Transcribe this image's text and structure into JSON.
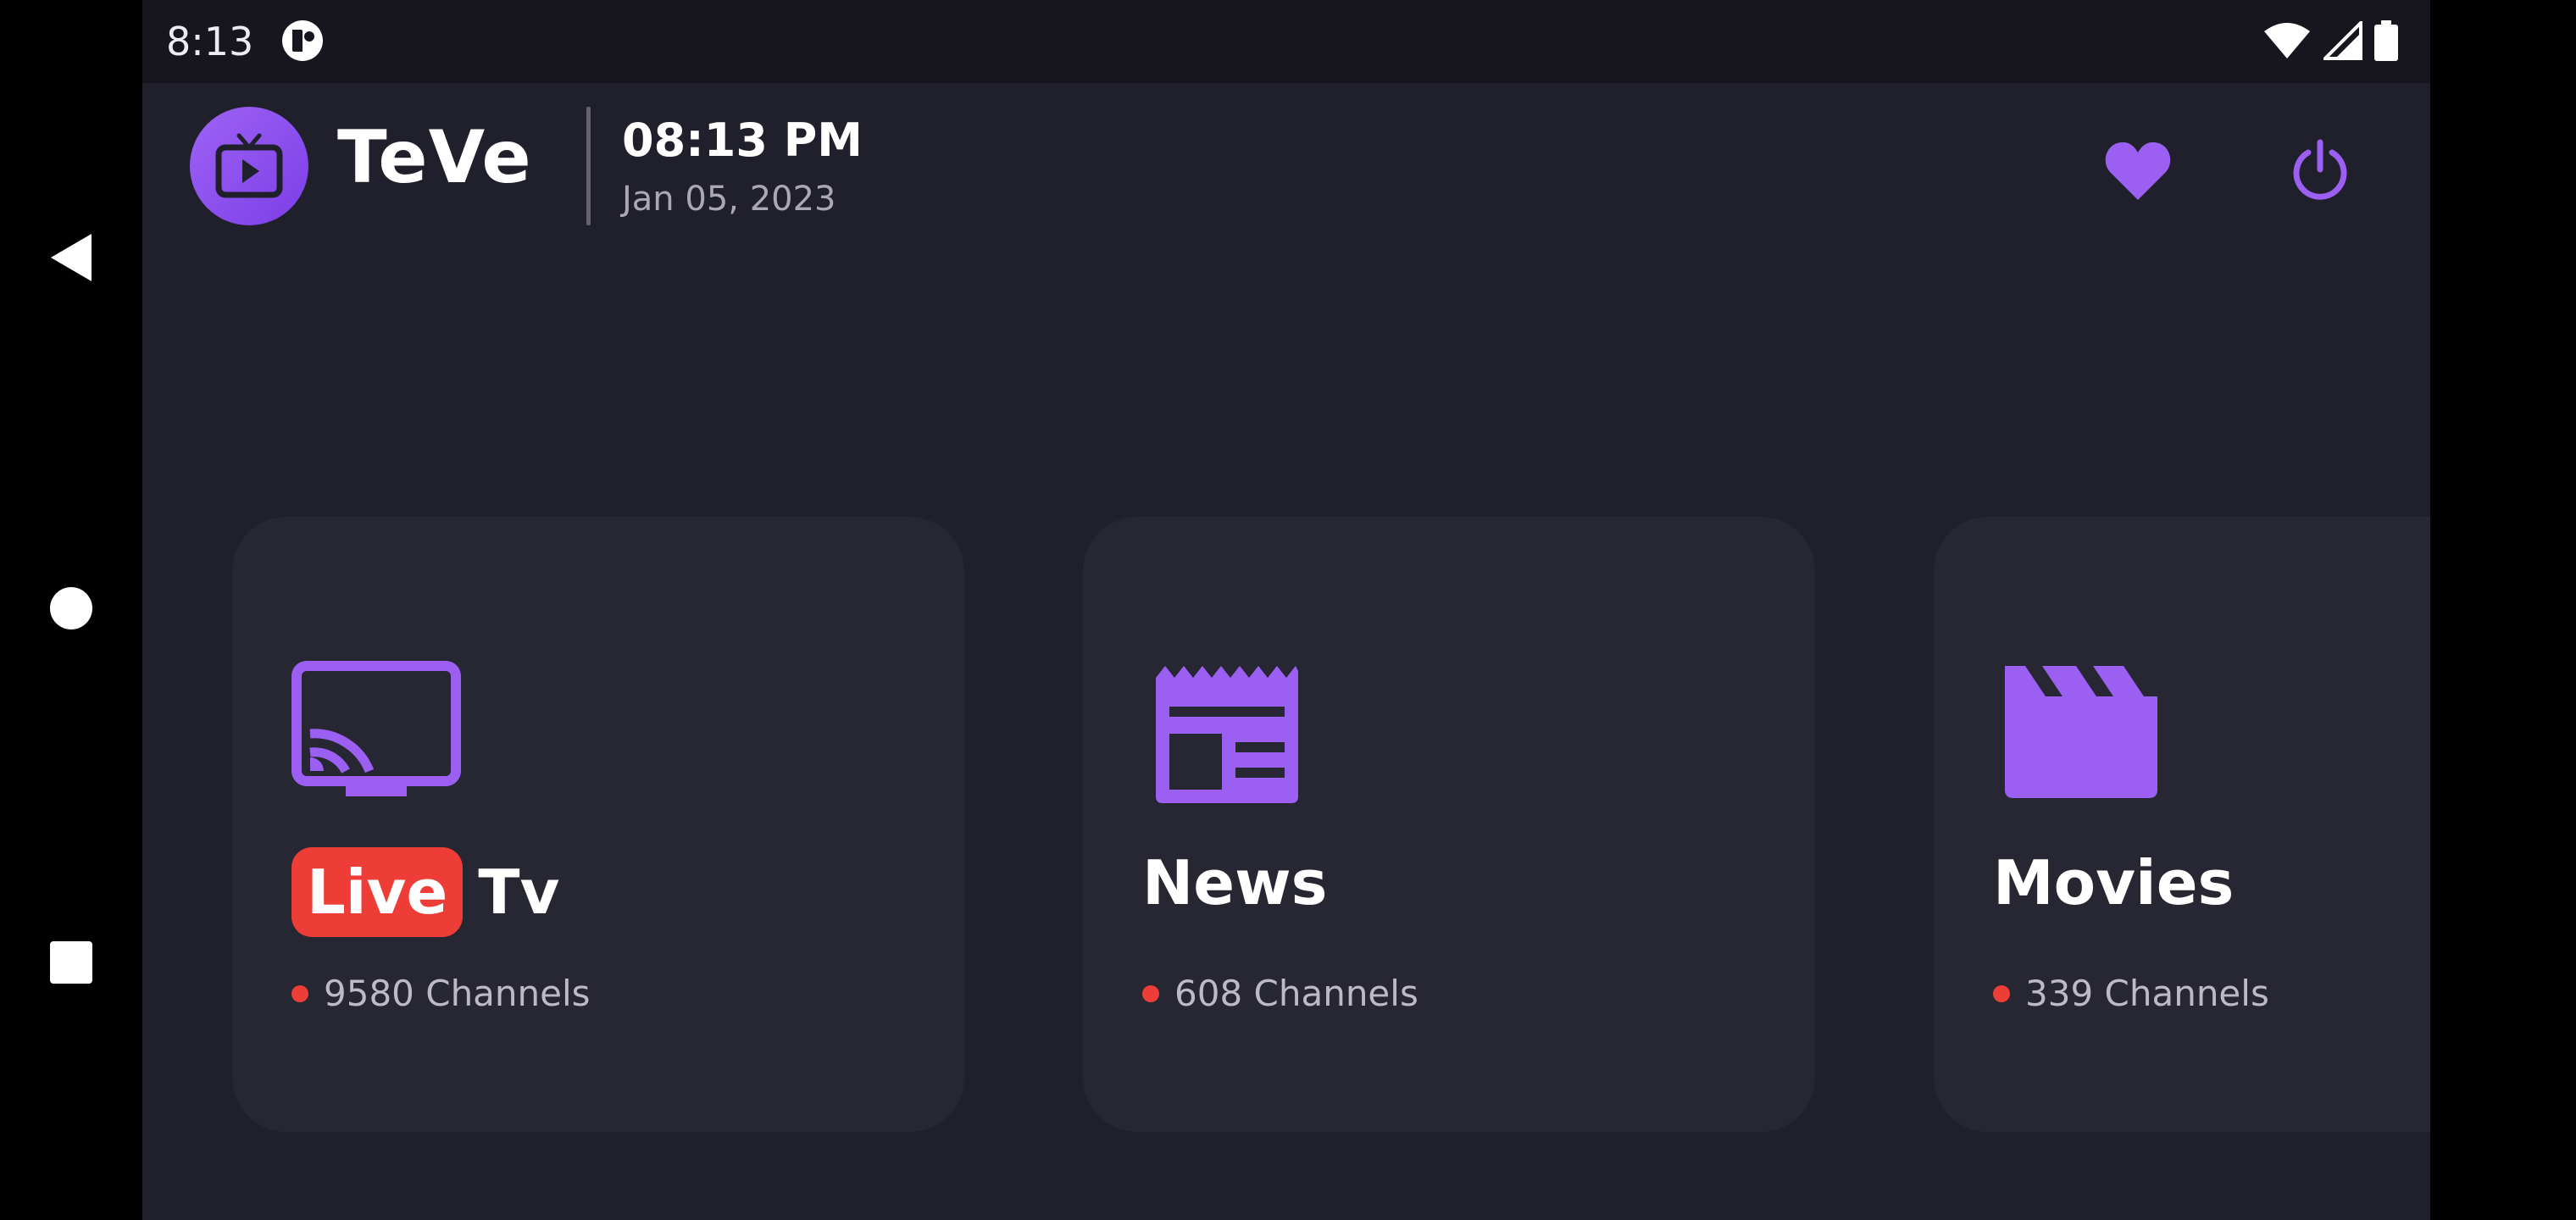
{
  "status_bar": {
    "time": "8:13",
    "icons": [
      "app-notification-icon",
      "wifi-icon",
      "cell-signal-icon",
      "battery-icon"
    ]
  },
  "nav_bar": {
    "buttons": [
      "back-icon",
      "home-icon",
      "recents-icon"
    ]
  },
  "header": {
    "app_name": "TeVe",
    "logo_icon": "tv-play-icon",
    "time": "08:13 PM",
    "date": "Jan 05, 2023",
    "actions": [
      "heart-icon",
      "power-icon"
    ]
  },
  "categories": [
    {
      "badge": "Live",
      "title": "Tv",
      "count": "9580 Channels",
      "icon": "cast-tv-icon"
    },
    {
      "title": "News",
      "count": "608 Channels",
      "icon": "newspaper-icon"
    },
    {
      "title": "Movies",
      "count": "339 Channels",
      "icon": "clapperboard-icon"
    }
  ],
  "colors": {
    "accent": "#9b5ff2",
    "live_red": "#ee3d37",
    "background": "#201f2c",
    "card": "#272633"
  }
}
